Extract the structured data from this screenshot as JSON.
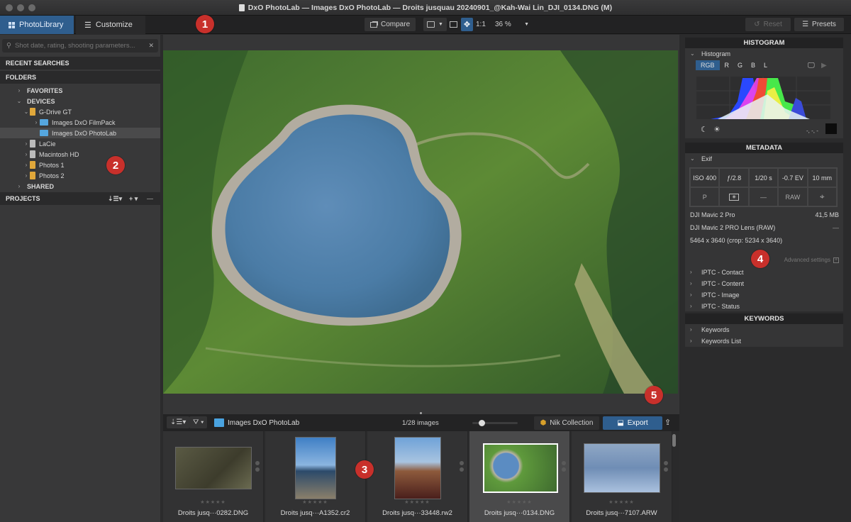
{
  "window": {
    "title": "DxO PhotoLab — Images DxO PhotoLab — Droits jusquau 20240901_@Kah-Wai Lin_DJI_0134.DNG (M)"
  },
  "toolbar": {
    "tabs": [
      {
        "label": "PhotoLibrary",
        "icon": "grid-icon",
        "active": true
      },
      {
        "label": "Customize",
        "icon": "sliders-icon",
        "active": false
      }
    ],
    "compare_label": "Compare",
    "one_to_one_label": "1:1",
    "zoom_value": "36 %",
    "reset_label": "Reset",
    "presets_label": "Presets"
  },
  "badges": [
    "1",
    "2",
    "3",
    "4",
    "5"
  ],
  "sidebar": {
    "search_placeholder": "Shot date, rating, shooting parameters...",
    "recent_searches": "RECENT SEARCHES",
    "folders": "FOLDERS",
    "projects": "PROJECTS",
    "tree": [
      {
        "label": "FAVORITES",
        "level": 0,
        "expanded": false,
        "bold": true
      },
      {
        "label": "DEVICES",
        "level": 0,
        "expanded": true,
        "bold": true
      },
      {
        "label": "G-Drive GT",
        "level": 1,
        "expanded": true,
        "icon": "drive"
      },
      {
        "label": "Images DxO FilmPack",
        "level": 2,
        "expanded": false,
        "icon": "folder"
      },
      {
        "label": "Images DxO PhotoLab",
        "level": 2,
        "expanded": null,
        "icon": "folder",
        "selected": true
      },
      {
        "label": "LaCie",
        "level": 1,
        "expanded": false,
        "icon": "drive-gray"
      },
      {
        "label": "Macintosh HD",
        "level": 1,
        "expanded": false,
        "icon": "drive-gray"
      },
      {
        "label": "Photos 1",
        "level": 1,
        "expanded": false,
        "icon": "drive"
      },
      {
        "label": "Photos 2",
        "level": 1,
        "expanded": false,
        "icon": "drive"
      },
      {
        "label": "SHARED",
        "level": 0,
        "expanded": false,
        "bold": true
      }
    ]
  },
  "right_panel": {
    "histogram_header": "HISTOGRAM",
    "histogram_label": "Histogram",
    "channels": [
      "RGB",
      "R",
      "G",
      "B",
      "L"
    ],
    "active_channel": "RGB",
    "readout": "-, -, -",
    "metadata_header": "METADATA",
    "exif_label": "Exif",
    "exif_row1": [
      "ISO 400",
      "ƒ/2.8",
      "1/20 s",
      "-0.7 EV",
      "10 mm"
    ],
    "exif_row2": [
      "P",
      "metering-icon",
      "—",
      "RAW",
      "location-icon"
    ],
    "camera": "DJI Mavic 2 Pro",
    "file_size": "41,5 MB",
    "lens": "DJI Mavic 2 PRO Lens (RAW)",
    "lens_value": "—",
    "dimensions": "5464 x 3640 (crop: 5234 x 3640)",
    "advanced_settings": "Advanced settings",
    "iptc": [
      "IPTC - Contact",
      "IPTC - Content",
      "IPTC - Image",
      "IPTC - Status"
    ],
    "keywords_header": "KEYWORDS",
    "keywords": [
      "Keywords",
      "Keywords List"
    ]
  },
  "filmstrip": {
    "folder_name": "Images DxO PhotoLab",
    "count": "1/28 images",
    "zoom_slider": 0.2,
    "nik_label": "Nik Collection",
    "export_label": "Export",
    "items": [
      {
        "name": "Droits jusq···0282.DNG",
        "rating": 0,
        "selected": false
      },
      {
        "name": "Droits jusq···A1352.cr2",
        "rating": 0,
        "selected": false
      },
      {
        "name": "Droits jusq···33448.rw2",
        "rating": 0,
        "selected": false
      },
      {
        "name": "Droits jusq···0134.DNG",
        "rating": 0,
        "selected": true
      },
      {
        "name": "Droits jusq···7107.ARW",
        "rating": 0,
        "selected": false
      }
    ]
  },
  "colors": {
    "accent": "#2f5e8e",
    "badge": "#c8302b"
  }
}
